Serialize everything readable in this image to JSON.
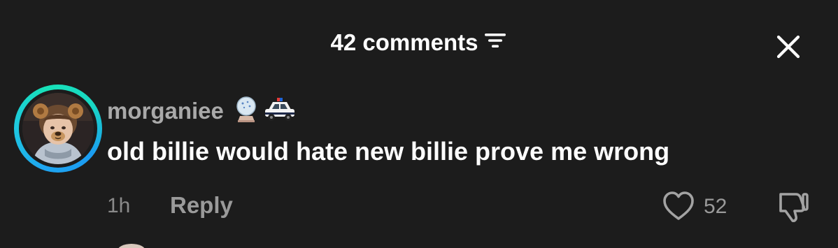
{
  "header": {
    "comment_count_label": "42 comments",
    "filter_icon": "filter-lines-icon",
    "close_icon": "close-x-icon"
  },
  "comment": {
    "username": "morganiee",
    "username_emojis": [
      "snow-globe-emoji",
      "police-car-emoji"
    ],
    "text": "old billie would hate new billie prove me wrong",
    "timestamp": "1h",
    "reply_label": "Reply",
    "like_count": "52",
    "like_icon": "heart-outline-icon",
    "dislike_icon": "thumbs-down-icon"
  },
  "colors": {
    "background": "#1c1c1c",
    "primary_text": "#ffffff",
    "secondary_text": "#a9a9a9",
    "avatar_ring_start": "#1fa5f0",
    "avatar_ring_end": "#17e2b8"
  }
}
